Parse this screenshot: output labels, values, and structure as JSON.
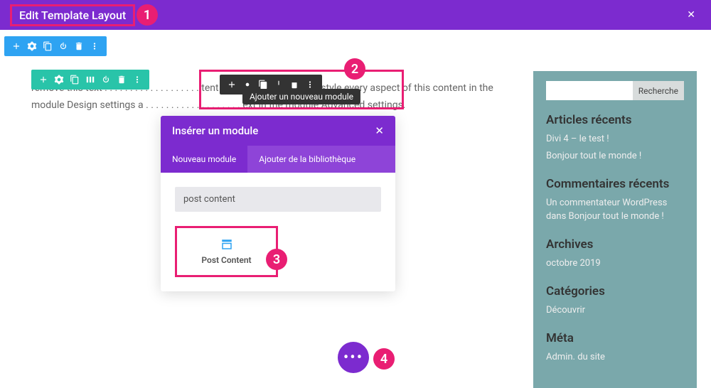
{
  "topbar": {
    "title": "Edit Template Layout"
  },
  "tooltip": "Ajouter un nouveau module",
  "content_text": "remove this text . . . . . . . . . . . . . . . . . . . tent settings. You can also style every aspect of this content in the module Design settings a . . . . . . . . . . . . . . . . . . . ext in the module Advanced settings.",
  "modal": {
    "title": "Insérer un module",
    "tab_new": "Nouveau module",
    "tab_lib": "Ajouter de la bibliothèque",
    "search_value": "post content",
    "result_label": "Post Content"
  },
  "sidebar": {
    "search_button": "Recherche",
    "sections": {
      "recent_posts": {
        "heading": "Articles récents",
        "items": [
          "Divi 4 – le test !",
          "Bonjour tout le monde !"
        ]
      },
      "recent_comments": {
        "heading": "Commentaires récents",
        "items": [
          "Un commentateur WordPress dans Bonjour tout le monde !"
        ]
      },
      "archives": {
        "heading": "Archives",
        "items": [
          "octobre 2019"
        ]
      },
      "categories": {
        "heading": "Catégories",
        "items": [
          "Découvrir"
        ]
      },
      "meta": {
        "heading": "Méta",
        "items": [
          "Admin. du site"
        ]
      }
    }
  },
  "markers": {
    "m1": "1",
    "m2": "2",
    "m3": "3",
    "m4": "4"
  }
}
